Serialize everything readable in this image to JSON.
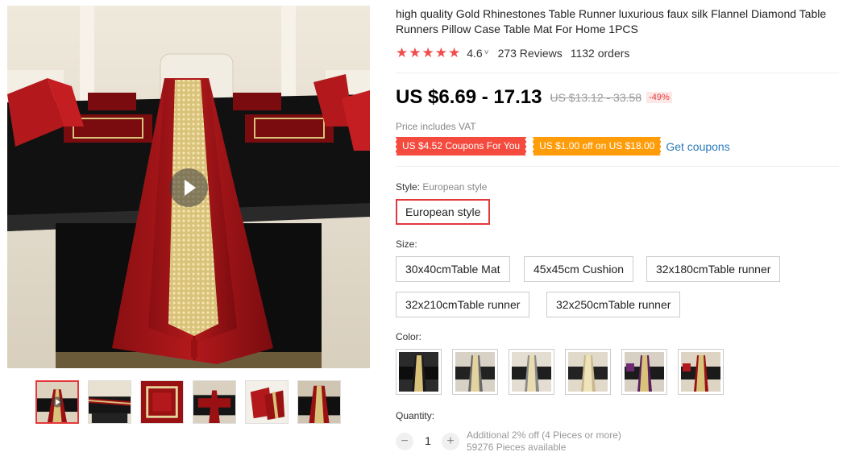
{
  "gallery": {
    "play_icon": "play-icon",
    "thumbnails": [
      {
        "name": "thumb-1",
        "active": true
      },
      {
        "name": "thumb-2",
        "active": false
      },
      {
        "name": "thumb-3",
        "active": false
      },
      {
        "name": "thumb-4",
        "active": false
      },
      {
        "name": "thumb-5",
        "active": false
      },
      {
        "name": "thumb-6",
        "active": false
      }
    ]
  },
  "product": {
    "title": "high quality Gold Rhinestones Table Runner luxurious faux silk Flannel Diamond Table Runners Pillow Case Table Mat For Home 1PCS",
    "rating": "4.6",
    "rating_chevron": "˅",
    "stars": 5,
    "reviews": "273 Reviews",
    "orders": "1132 orders"
  },
  "pricing": {
    "price": "US $6.69 - 17.13",
    "old_price": "US $13.12 - 33.58",
    "discount": "-49%",
    "vat_note": "Price includes VAT",
    "coupons": [
      {
        "label": "US $4.52 Coupons For You",
        "color": "#f44b3e"
      },
      {
        "label": "US $1.00 off on US $18.00",
        "color": "#ff9c09"
      }
    ],
    "get_coupons": "Get coupons"
  },
  "style": {
    "label": "Style:",
    "value": "European style",
    "options": [
      "European style"
    ]
  },
  "size": {
    "label": "Size:",
    "options": [
      "30x40cmTable Mat",
      "45x45cm Cushion",
      "32x180cmTable runner",
      "32x210cmTable runner",
      "32x250cmTable runner"
    ]
  },
  "color": {
    "label": "Color:",
    "swatches": [
      "black-gold",
      "grey-gold",
      "grey-gold-2",
      "beige-gold",
      "purple-gold",
      "red-gold"
    ]
  },
  "quantity": {
    "label": "Quantity:",
    "value": "1",
    "minus": "−",
    "plus": "+",
    "note_line1": "Additional 2% off (4 Pieces or more)",
    "note_line2": "59276 Pieces available"
  },
  "colors": {
    "accent": "#e4393c",
    "star": "#f04d4d",
    "link": "#2a7ab8"
  }
}
